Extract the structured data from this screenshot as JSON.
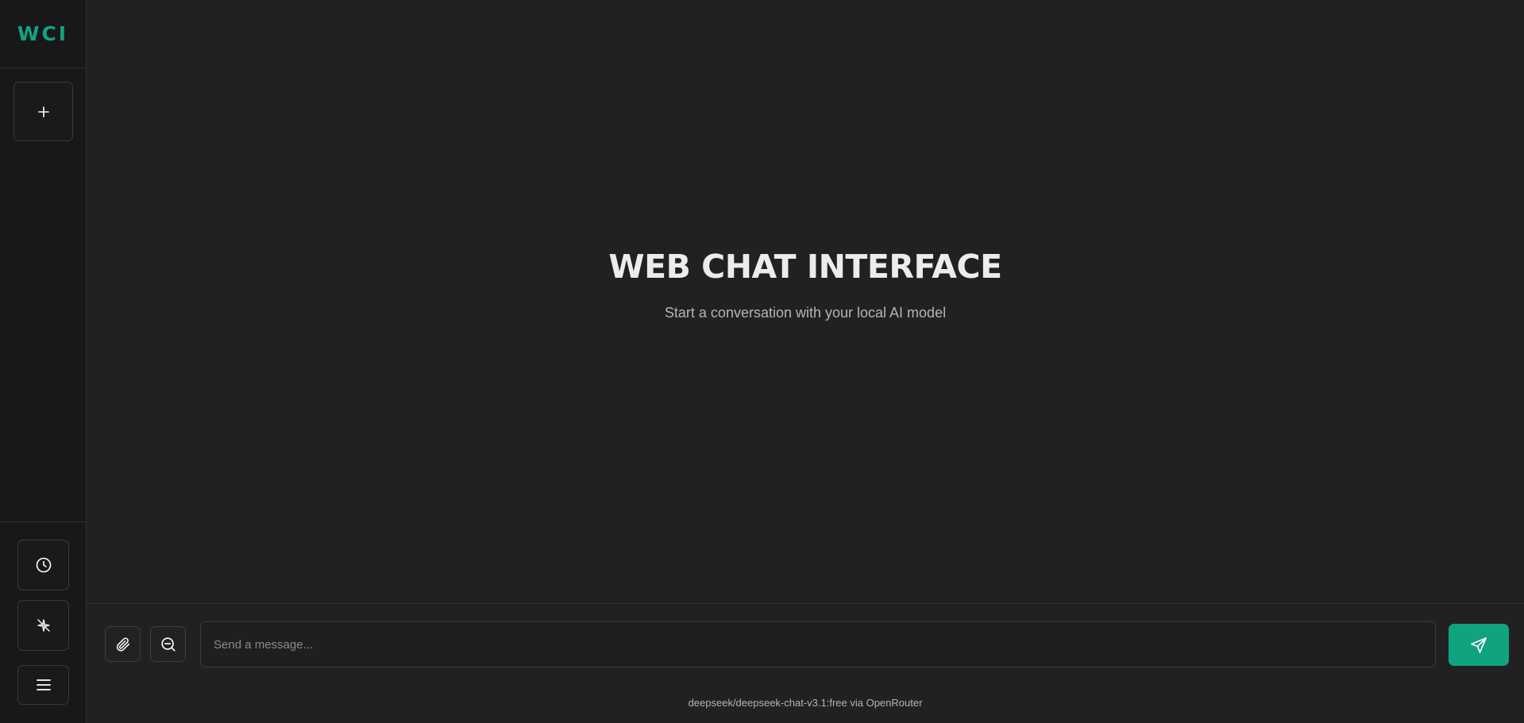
{
  "app": {
    "logo": "WCI",
    "accent_color": "#10a37f"
  },
  "sidebar": {
    "new_chat_icon": "plus-icon",
    "history_icon": "clock-icon",
    "model_icon": "sparkle-icon",
    "menu_icon": "hamburger-menu-icon"
  },
  "welcome": {
    "title": "WEB CHAT INTERFACE",
    "subtitle": "Start a conversation with your local AI model"
  },
  "composer": {
    "attach_icon": "paperclip-icon",
    "zoom_icon": "zoom-out-icon",
    "placeholder": "Send a message...",
    "value": "",
    "send_icon": "send-icon"
  },
  "footer": {
    "model_info": "deepseek/deepseek-chat-v3.1:free via OpenRouter"
  }
}
